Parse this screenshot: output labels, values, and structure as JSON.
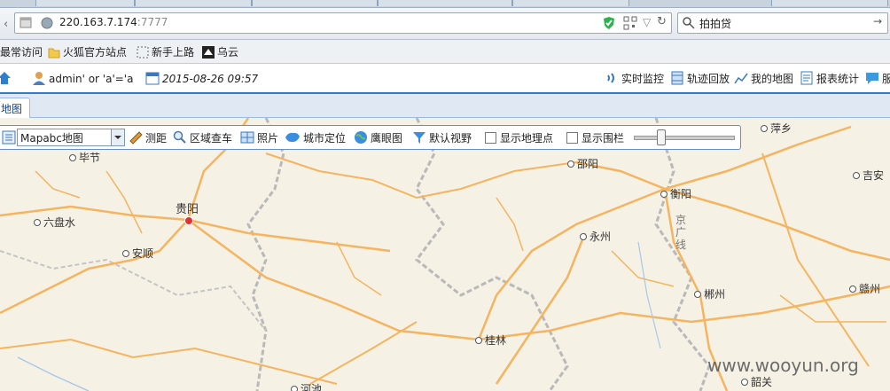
{
  "browser": {
    "url_host": "220.163.7.174",
    "url_port": ":7777",
    "search_value": "拍拍贷"
  },
  "bookmarks": [
    "最常访问",
    "火狐官方站点",
    "新手上路",
    "乌云"
  ],
  "appbar": {
    "user": "admin' or 'a'='a",
    "datetime": "2015-08-26 09:57",
    "menu": [
      "实时监控",
      "轨迹回放",
      "我的地图",
      "报表统计",
      "服"
    ]
  },
  "tabs": [
    "地图"
  ],
  "toolbar": {
    "map_source": "Mapabc地图",
    "items": [
      "测距",
      "区域查车",
      "照片",
      "城市定位",
      "鹰眼图",
      "默认视野"
    ],
    "checks": [
      "显示地理点",
      "显示围栏"
    ]
  },
  "map": {
    "cities": [
      "毕节",
      "六盘水",
      "贵阳",
      "安顺",
      "邵阳",
      "衡阳",
      "永州",
      "郴州",
      "桂林",
      "萍乡",
      "吉安",
      "赣州",
      "韶关",
      "河池"
    ],
    "rail_label": [
      "京",
      "广",
      "线"
    ]
  },
  "watermark": "www.wooyun.org"
}
